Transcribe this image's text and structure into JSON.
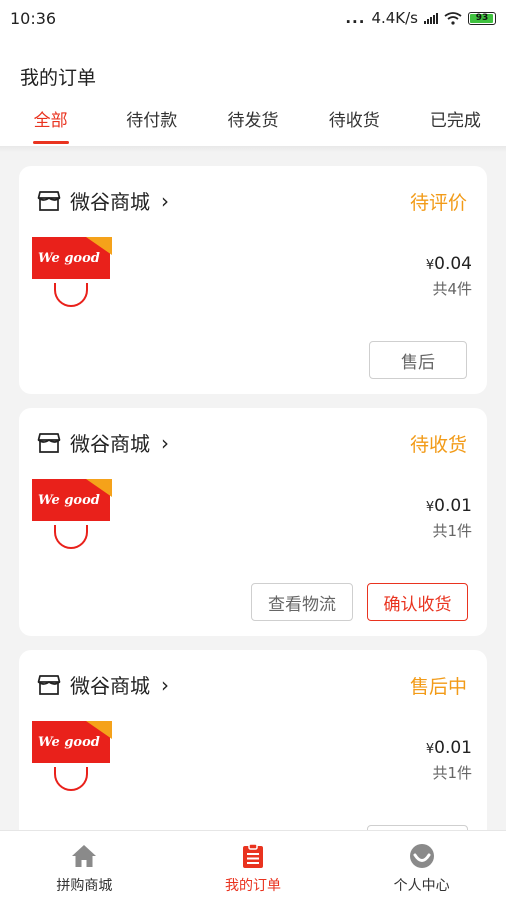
{
  "status_bar": {
    "time": "10:36",
    "dots": "...",
    "network_speed": "4.4K/s",
    "battery": "93"
  },
  "header": {
    "title": "我的订单",
    "tabs": [
      {
        "label": "全部",
        "active": true
      },
      {
        "label": "待付款",
        "active": false
      },
      {
        "label": "待发货",
        "active": false
      },
      {
        "label": "待收货",
        "active": false
      },
      {
        "label": "已完成",
        "active": false
      }
    ]
  },
  "orders": [
    {
      "store": "微谷商城",
      "status": "待评价",
      "product_logo": "We good",
      "price_symbol": "¥",
      "price": "0.04",
      "quantity": "共4件",
      "buttons": [
        {
          "label": "售后",
          "primary": false
        }
      ]
    },
    {
      "store": "微谷商城",
      "status": "待收货",
      "product_logo": "We good",
      "price_symbol": "¥",
      "price": "0.01",
      "quantity": "共1件",
      "buttons": [
        {
          "label": "查看物流",
          "primary": false
        },
        {
          "label": "确认收货",
          "primary": true
        }
      ]
    },
    {
      "store": "微谷商城",
      "status": "售后中",
      "product_logo": "We good",
      "price_symbol": "¥",
      "price": "0.01",
      "quantity": "共1件",
      "buttons": []
    }
  ],
  "bottom_nav": [
    {
      "label": "拼购商城",
      "icon": "home-icon",
      "active": false
    },
    {
      "label": "我的订单",
      "icon": "order-clipboard-icon",
      "active": true
    },
    {
      "label": "个人中心",
      "icon": "profile-face-icon",
      "active": false
    }
  ],
  "colors": {
    "accent": "#e9331f",
    "status_orange": "#f29b18",
    "background": "#f3f3f3"
  }
}
